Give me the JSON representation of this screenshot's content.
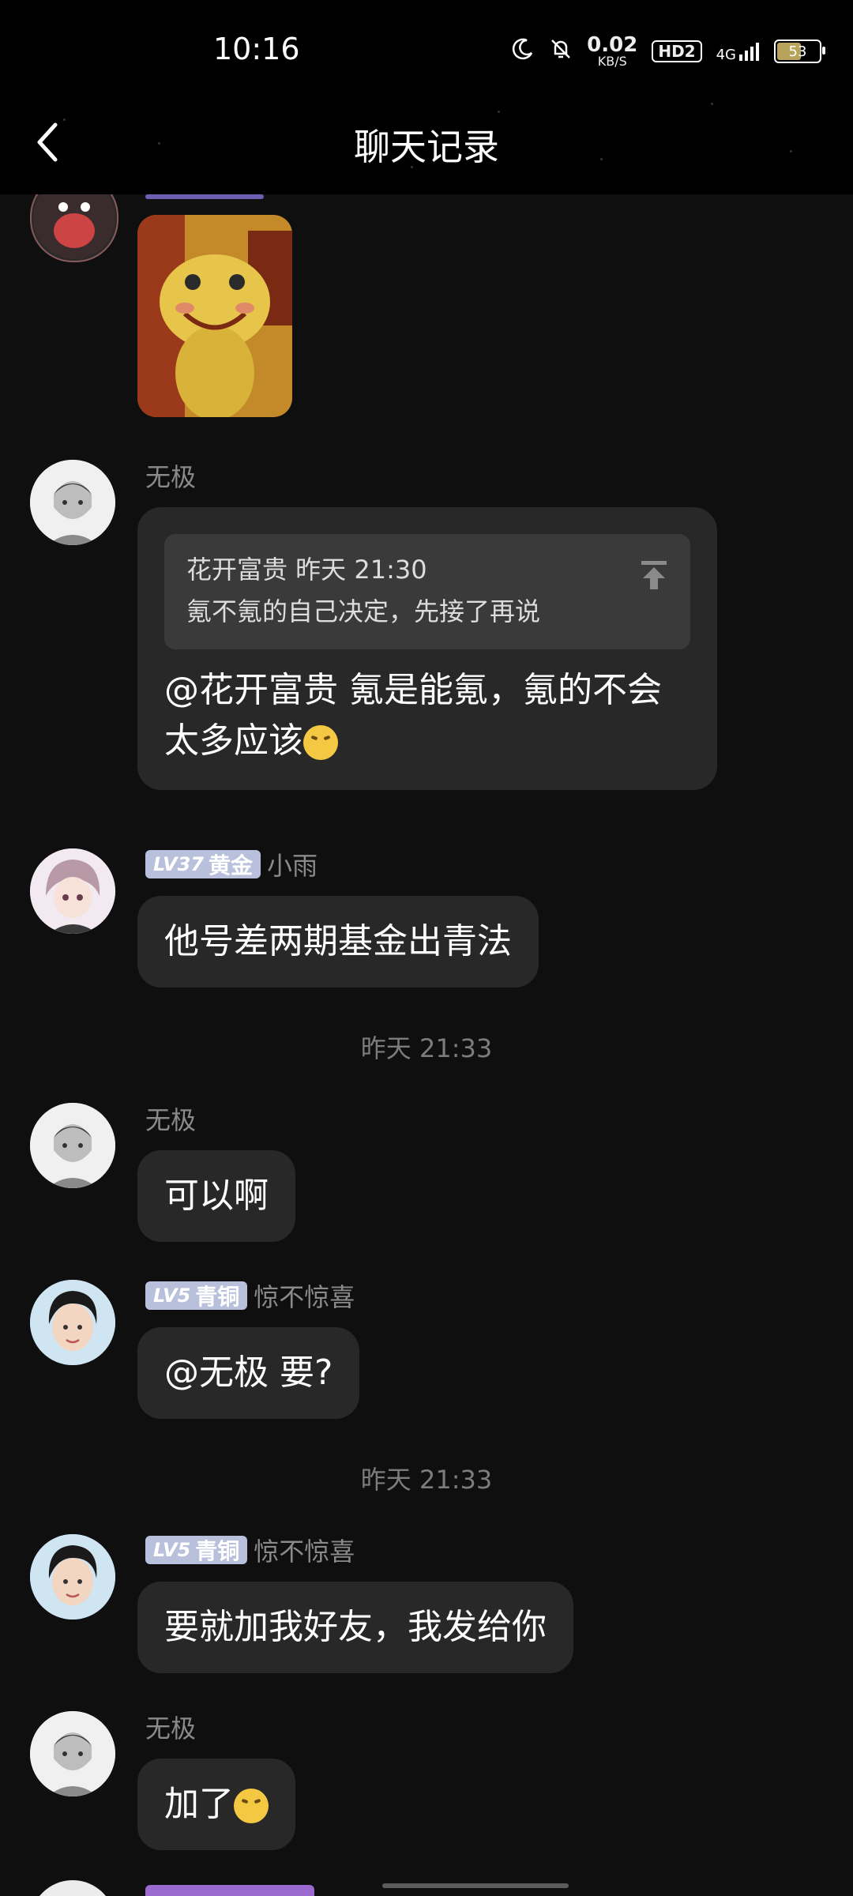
{
  "status_bar": {
    "time": "10:16",
    "net_speed_value": "0.02",
    "net_speed_unit": "KB/S",
    "hd_label": "HD2",
    "signal_label": "4G",
    "battery_level": "53",
    "battery_fraction": 0.53
  },
  "header": {
    "title": "聊天记录",
    "back_icon": "chevron-left-icon"
  },
  "messages": [
    {
      "type": "sticker",
      "sticker_icon": "frog-sticker"
    },
    {
      "type": "reply",
      "sender": "无极",
      "quote": {
        "author_time": "花开富贵 昨天 21:30",
        "text": "氪不氪的自己决定，先接了再说",
        "icon": "jump-to-top-icon"
      },
      "text": "@花开富贵 氪是能氪，氪的不会太多应该",
      "emoji": "squint-emoji"
    },
    {
      "type": "text",
      "badge_lv": "LV37",
      "badge_tier": "黄金",
      "badge_color": "#b6bcd8",
      "sender": "小雨",
      "text": "他号差两期基金出青法"
    },
    {
      "type": "time",
      "text": "昨天 21:33"
    },
    {
      "type": "text",
      "sender": "无极",
      "text": "可以啊"
    },
    {
      "type": "text",
      "badge_lv": "LV5",
      "badge_tier": "青铜",
      "badge_color": "#b8c0dc",
      "sender": "惊不惊喜",
      "text": "@无极 要?"
    },
    {
      "type": "time",
      "text": "昨天 21:33"
    },
    {
      "type": "text",
      "badge_lv": "LV5",
      "badge_tier": "青铜",
      "sender": "惊不惊喜",
      "text": "要就加我好友，我发给你"
    },
    {
      "type": "text",
      "sender": "无极",
      "text": "加了",
      "emoji": "squint-emoji"
    }
  ],
  "colors": {
    "background": "#0f0f0f",
    "bubble": "#282828",
    "quote_card": "#3a3a3a",
    "username": "#8a8a8a",
    "badge": "#b8c0dc"
  }
}
